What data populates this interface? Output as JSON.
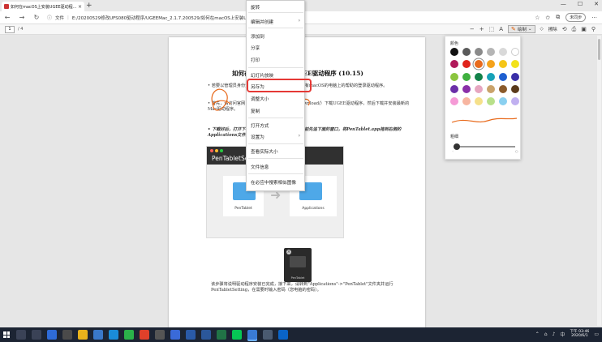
{
  "browser": {
    "tab_title": "如何在macOS上安装UGEE驱动程...",
    "tab_close": "×",
    "new_tab": "+",
    "window_controls": [
      "—",
      "☐",
      "✕"
    ],
    "address_prefix": "文件",
    "address": "E:/20200529修改UFS080驱动程序/UGEEMac_2.1.7.200529/如何在macOS上安装UGEE驱动程序.pdf",
    "profile": "未同步"
  },
  "pdf_toolbar": {
    "page_current": "1",
    "page_total": "/ 4",
    "draw_label": "绘制",
    "erase_label": "擦除"
  },
  "document": {
    "heading": "如何在macOS上安装UGEE驱动程序 (10.15)",
    "bullet1": "• 若要以管理员身份登录您的Mac电脑，请参阅在装有macOS的电脑上的帮助的登录驱动程序。",
    "bullet2": "• 首先，请访问官网（https://www.ugee.com/download/）下载UGEE驱动程序，然后下载并安装最新的Mac驱动程序。",
    "bullet3": "• 下载好后，打开下载的驱动程序安装包，在安装之前先追下面的窗口，将PenTablet.app拖到右侧的Applications文件夹。",
    "screenshot_title": "PenTabletSetting",
    "panel_left_label": "PenTablet",
    "panel_right_label": "Applications",
    "disk_label": "PenTablet",
    "footer": "该步骤将说明驱动程序安装已完成，接下来，请转到\"Applications\"->\"PenTablet\"文件夹并运行PenTabletSetting，在需要时输入密码（您电脑的密码）。"
  },
  "context_menu": {
    "items": [
      {
        "label": "旋转",
        "submenu": false
      },
      {
        "label": "编辑并创建",
        "submenu": true
      },
      {
        "label": "添加到",
        "submenu": false
      },
      {
        "label": "分享",
        "submenu": false
      },
      {
        "label": "打印",
        "submenu": false
      },
      {
        "label": "幻灯片放映",
        "submenu": false
      },
      {
        "label": "另存为",
        "submenu": false
      },
      {
        "label": "调整大小",
        "submenu": false
      },
      {
        "label": "复制",
        "submenu": false
      },
      {
        "label": "打开方式",
        "submenu": false
      },
      {
        "label": "设置为",
        "submenu": true
      },
      {
        "label": "查看实际大小",
        "submenu": false
      },
      {
        "label": "文件信息",
        "submenu": false
      },
      {
        "label": "在必应中搜索相似图像",
        "submenu": false
      }
    ],
    "highlighted": "另存为"
  },
  "draw_panel": {
    "color_label": "颜色",
    "size_label": "粗细",
    "size_value": 0.05,
    "colors": [
      "#111111",
      "#5a5a5a",
      "#8a8a8a",
      "#b5b5b5",
      "#d9d9d9",
      "#ffffff",
      "#b0195a",
      "#e0241c",
      "#e86a1c",
      "#f4a21b",
      "#f5c518",
      "#f2e21a",
      "#8bc53f",
      "#3fb03f",
      "#13824a",
      "#17a2b8",
      "#1e5fd0",
      "#3a2fa8",
      "#6b2fa8",
      "#8a2fa8",
      "#e6a6c0",
      "#c9a36b",
      "#8a5a2b",
      "#5a3a1b",
      "#f59ad6",
      "#f7b5a0",
      "#f5e08a",
      "#b8e08a",
      "#8ad0f0",
      "#c0b0f0"
    ],
    "selected_color": "#e86a1c"
  },
  "taskbar": {
    "time": "下午 03:46",
    "date": "2020/6/1",
    "icons": [
      "search",
      "taskview",
      "mail",
      "store",
      "explorer",
      "files",
      "edge",
      "wechat",
      "chrome",
      "unknown",
      "shield",
      "security",
      "word",
      "excel",
      "line",
      "active-app",
      "settings",
      "outlook"
    ]
  }
}
